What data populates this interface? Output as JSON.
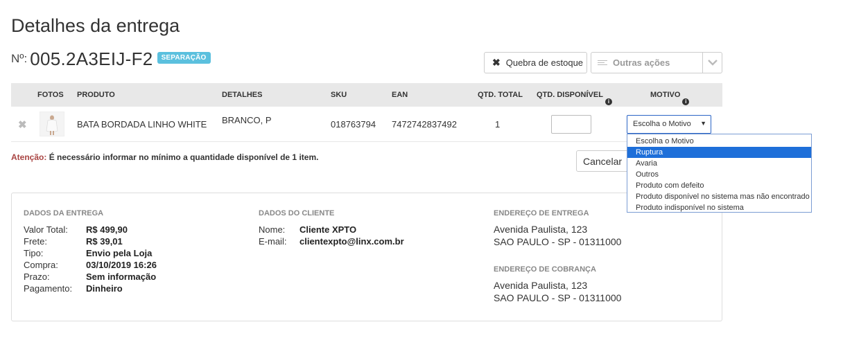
{
  "page_title": "Detalhes da entrega",
  "order": {
    "prefix": "Nº:",
    "number": "005.2A3EIJ-F2",
    "status": "SEPARAÇÃO"
  },
  "actions": {
    "quebra_label": "Quebra de estoque",
    "outras_label": "Outras ações"
  },
  "table": {
    "headers": [
      "FOTOS",
      "PRODUTO",
      "DETALHES",
      "SKU",
      "EAN",
      "QTD. TOTAL",
      "QTD. DISPONÍVEL",
      "MOTIVO"
    ],
    "row": {
      "product": "BATA BORDADA LINHO WHITE",
      "details": "BRANCO, P",
      "sku": "018763794",
      "ean": "7472742837492",
      "qty_total": "1",
      "motivo_selected": "Escolha o Motivo"
    }
  },
  "motivo_options": [
    "Escolha o Motivo",
    "Ruptura",
    "Avaria",
    "Outros",
    "Produto com defeito",
    "Produto disponível no sistema mas não encontrado",
    "Produto indisponível no sistema"
  ],
  "motivo_highlighted": "Ruptura",
  "warning": {
    "label": "Atenção:",
    "text": "É necessário informar no mínimo a quantidade disponível de 1 item."
  },
  "cancel_label": "Cancelar",
  "delivery": {
    "title": "DADOS DA ENTREGA",
    "fields": [
      {
        "label": "Valor Total:",
        "value": "R$ 499,90"
      },
      {
        "label": "Frete:",
        "value": "R$ 39,01"
      },
      {
        "label": "Tipo:",
        "value": "Envio pela Loja"
      },
      {
        "label": "Compra:",
        "value": "03/10/2019 16:26"
      },
      {
        "label": "Prazo:",
        "value": "Sem informação"
      },
      {
        "label": "Pagamento:",
        "value": "Dinheiro"
      }
    ]
  },
  "client": {
    "title": "DADOS DO CLIENTE",
    "fields": [
      {
        "label": "Nome:",
        "value": "Cliente XPTO"
      },
      {
        "label": "E-mail:",
        "value": "clientexpto@linx.com.br"
      }
    ]
  },
  "delivery_address": {
    "title": "ENDEREÇO DE ENTREGA",
    "line1": "Avenida Paulista, 123",
    "line2": "SAO PAULO - SP - 01311000"
  },
  "billing_address": {
    "title": "ENDEREÇO DE COBRANÇA",
    "line1": "Avenida Paulista, 123",
    "line2": "SAO PAULO - SP - 01311000"
  }
}
